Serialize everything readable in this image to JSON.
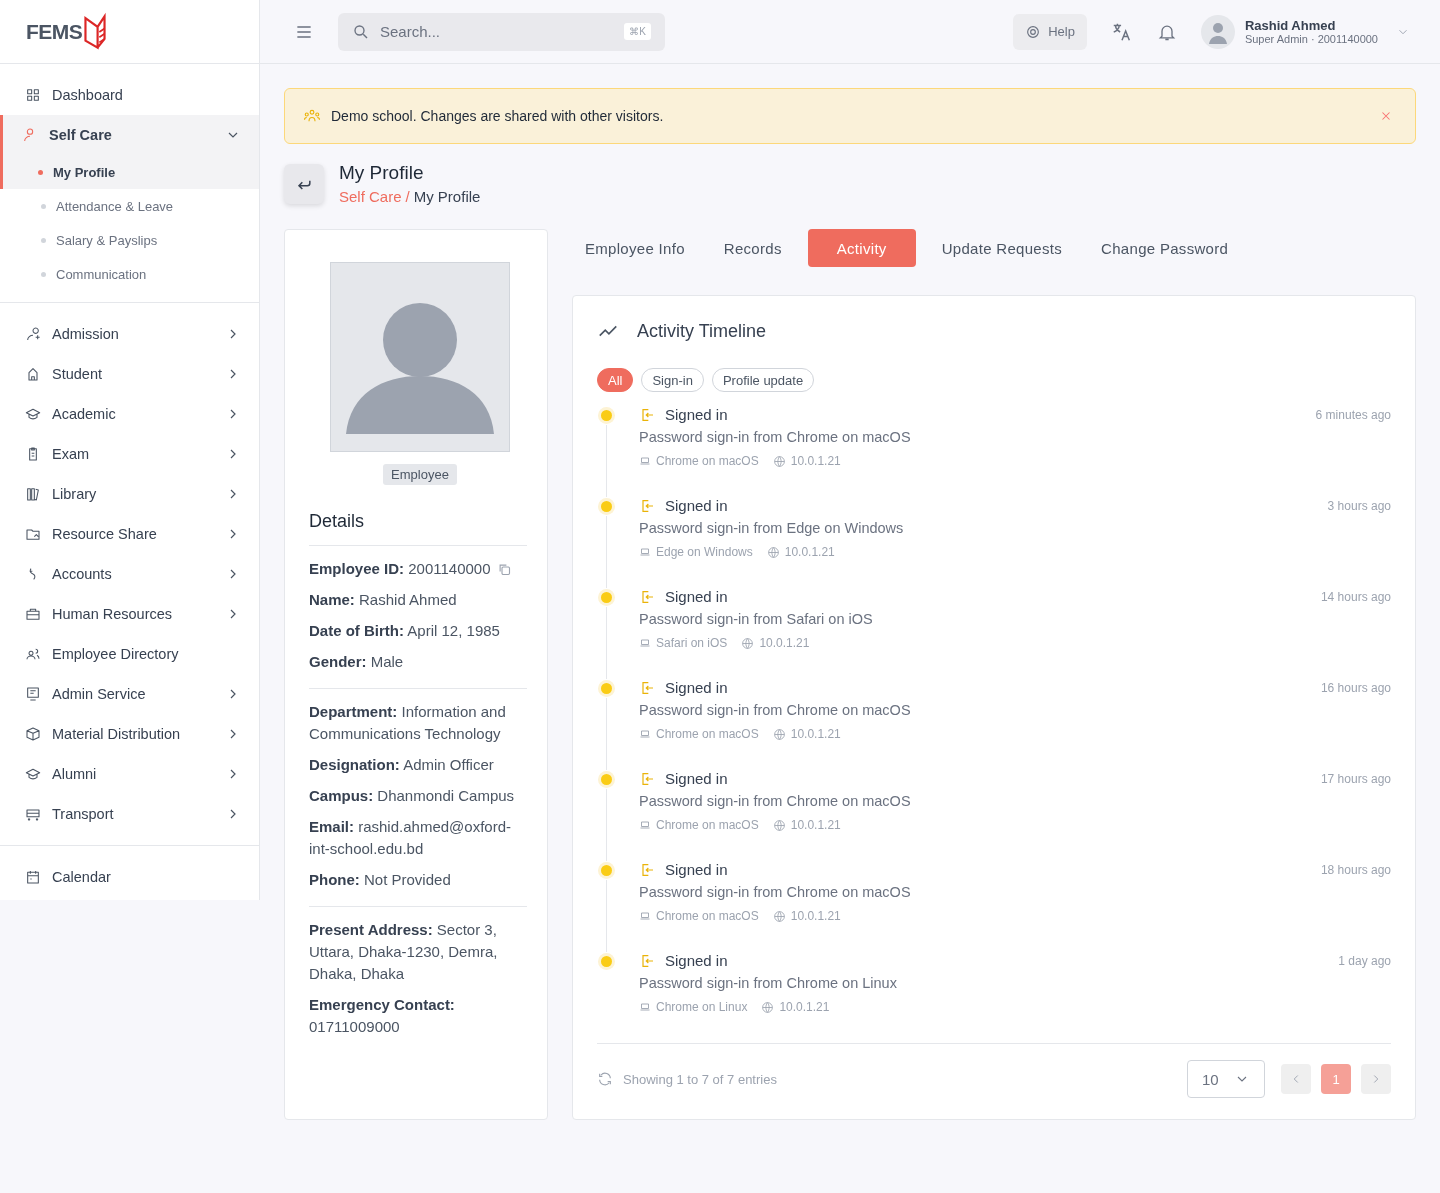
{
  "brand": {
    "logo_text": "FEMS"
  },
  "sidebar": {
    "groups": [
      {
        "items": [
          {
            "label": "Dashboard",
            "selected": false
          },
          {
            "label": "Self Care",
            "expanded": true,
            "selected": true,
            "children": [
              {
                "label": "My Profile",
                "selected": true
              },
              {
                "label": "Attendance & Leave",
                "selected": false
              },
              {
                "label": "Salary & Payslips",
                "selected": false
              },
              {
                "label": "Communication",
                "selected": false
              }
            ]
          }
        ]
      },
      {
        "items": [
          {
            "label": "Admission",
            "expanded": false,
            "selected": false
          },
          {
            "label": "Student",
            "expanded": false,
            "selected": false
          },
          {
            "label": "Academic",
            "expanded": false,
            "selected": false
          },
          {
            "label": "Exam",
            "expanded": false,
            "selected": false
          },
          {
            "label": "Library",
            "expanded": false,
            "selected": false
          },
          {
            "label": "Resource Share",
            "expanded": false,
            "selected": false
          },
          {
            "label": "Accounts",
            "expanded": false,
            "selected": false
          },
          {
            "label": "Human Resources",
            "expanded": false,
            "selected": false
          },
          {
            "label": "Employee Directory",
            "selected": false
          },
          {
            "label": "Admin Service",
            "expanded": false,
            "selected": false
          },
          {
            "label": "Material Distribution",
            "expanded": false,
            "selected": false
          },
          {
            "label": "Alumni",
            "expanded": false,
            "selected": false
          },
          {
            "label": "Transport",
            "expanded": false,
            "selected": false
          }
        ]
      },
      {
        "items": [
          {
            "label": "Calendar",
            "selected": false
          }
        ]
      }
    ]
  },
  "topbar": {
    "search": {
      "placeholder": "Search...",
      "shortcut": "⌘K"
    },
    "help": "Help",
    "user": {
      "name": "Rashid Ahmed",
      "role": "Super Admin · 2001140000"
    }
  },
  "banner": {
    "text": "Demo school. Changes are shared with other visitors."
  },
  "page": {
    "title": "My Profile",
    "breadcrumb": [
      "Self Care",
      "My Profile"
    ],
    "breadcrumb_separator": "/"
  },
  "profile": {
    "role_badge": "Employee",
    "details_title": "Details",
    "sections": [
      [
        "**Employee ID:** 2001140000",
        "**Name:** Rashid Ahmed",
        "**Date of Birth:** April 12, 1985",
        "**Gender:** Male"
      ],
      [
        "**Department:** Information and Communications Technology",
        "**Designation:** Admin Officer",
        "**Campus:** Dhanmondi Campus",
        "**Email:** rashid.ahmed@oxford-int-school.edu.bd",
        "**Phone:** Not Provided"
      ],
      [
        "**Present Address:** Sector 3, Uttara, Dhaka-1230, Demra, Dhaka, Dhaka",
        "**Emergency Contact:** 01711009000"
      ]
    ]
  },
  "tabs": [
    {
      "label": "Employee Info",
      "selected": false
    },
    {
      "label": "Records",
      "selected": false
    },
    {
      "label": "Activity",
      "selected": true
    },
    {
      "label": "Update Requests",
      "selected": false
    },
    {
      "label": "Change Password",
      "selected": false
    }
  ],
  "timeline": {
    "title": "Activity Timeline",
    "filters": [
      {
        "label": "All",
        "selected": true
      },
      {
        "label": "Sign-in",
        "selected": false
      },
      {
        "label": "Profile update",
        "selected": false
      }
    ],
    "events": [
      {
        "title": "Signed in",
        "description": "Password sign-in from Chrome on macOS",
        "device": "Chrome on macOS",
        "ip": "10.0.1.21",
        "time": "6 minutes ago"
      },
      {
        "title": "Signed in",
        "description": "Password sign-in from Edge on Windows",
        "device": "Edge on Windows",
        "ip": "10.0.1.21",
        "time": "3 hours ago"
      },
      {
        "title": "Signed in",
        "description": "Password sign-in from Safari on iOS",
        "device": "Safari on iOS",
        "ip": "10.0.1.21",
        "time": "14 hours ago"
      },
      {
        "title": "Signed in",
        "description": "Password sign-in from Chrome on macOS",
        "device": "Chrome on macOS",
        "ip": "10.0.1.21",
        "time": "16 hours ago"
      },
      {
        "title": "Signed in",
        "description": "Password sign-in from Chrome on macOS",
        "device": "Chrome on macOS",
        "ip": "10.0.1.21",
        "time": "17 hours ago"
      },
      {
        "title": "Signed in",
        "description": "Password sign-in from Chrome on macOS",
        "device": "Chrome on macOS",
        "ip": "10.0.1.21",
        "time": "18 hours ago"
      },
      {
        "title": "Signed in",
        "description": "Password sign-in from Chrome on Linux",
        "device": "Chrome on Linux",
        "ip": "10.0.1.21",
        "time": "1 day ago"
      }
    ],
    "summary": "Showing 1 to 7 of 7 entries",
    "page_size": "10",
    "pages": [
      {
        "label": "1",
        "selected": true
      }
    ]
  }
}
